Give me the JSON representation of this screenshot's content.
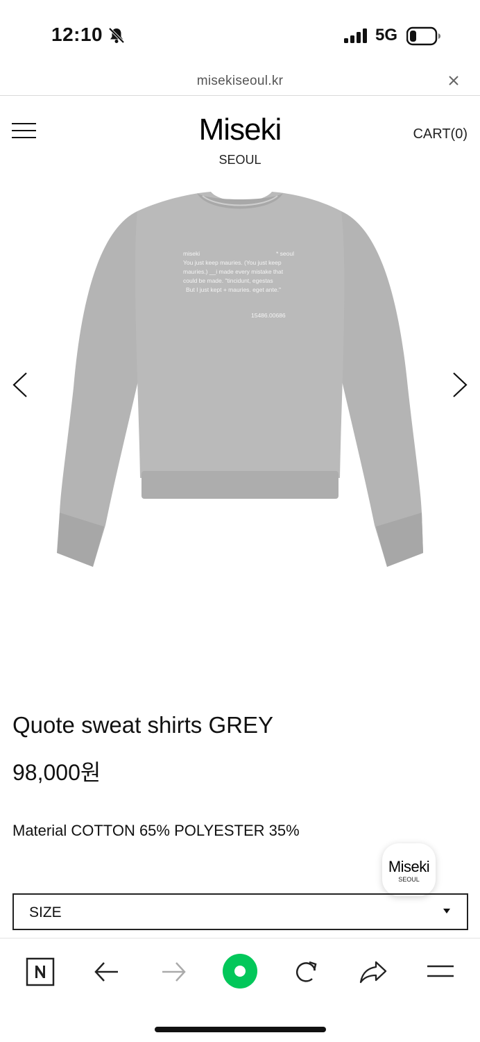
{
  "status_bar": {
    "time": "12:10",
    "network": "5G",
    "icons": [
      "bell-slash-icon",
      "signal-icon",
      "battery-icon"
    ]
  },
  "browser": {
    "url": "misekiseoul.kr",
    "close_icon": "close-icon"
  },
  "header": {
    "menu_icon": "hamburger-menu-icon",
    "logo_main": "Miseki",
    "logo_sub": "SEOUL",
    "cart_label": "CART(0)"
  },
  "product": {
    "image_alt": "grey sweatshirt",
    "print_lines": [
      "miseki",
      "* seoul",
      "You just keep mauries.   (You just keep",
      "mauries.) __i made every mistake that",
      "could be made.     \"tincidunt,  egestas",
      "But I just kept + mauries.     eget ante.\"",
      "15486.00686"
    ],
    "title": "Quote sweat shirts GREY",
    "price": "98,000원",
    "material": "Material COTTON 65% POLYESTER 35%"
  },
  "carousel": {
    "prev_icon": "chevron-left-icon",
    "next_icon": "chevron-right-icon"
  },
  "floating_badge": {
    "main": "Miseki",
    "sub": "SEOUL"
  },
  "size_select": {
    "label": "SIZE"
  },
  "toolbar": {
    "items": [
      "naver-n-icon",
      "back-arrow-icon",
      "forward-arrow-icon",
      "green-dot-icon",
      "refresh-icon",
      "share-icon",
      "menu-icon"
    ],
    "accent_color": "#03c75a"
  },
  "colors": {
    "sweater": "#b9b9b9",
    "sweater_shade": "#a9a9a9",
    "text": "#111111"
  }
}
